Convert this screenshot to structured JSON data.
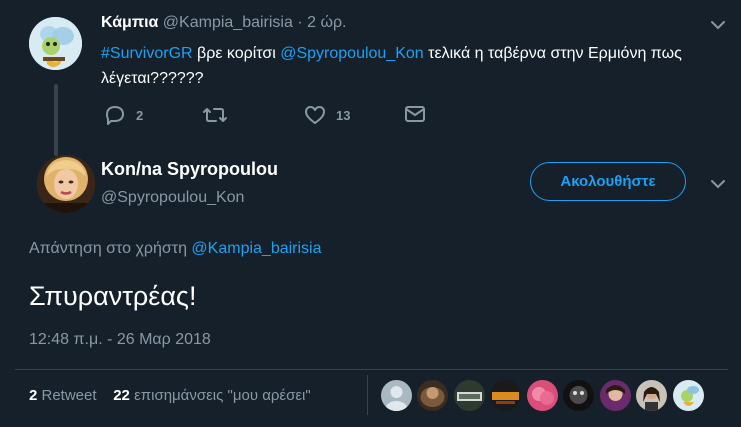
{
  "parent_tweet": {
    "author_name": "Κάμπια",
    "author_handle": "@Kampia_bairisia",
    "separator": "·",
    "time_ago": "2 ώρ.",
    "text_hashtag": "#SurvivorGR",
    "text_part1": " βρε κορίτσι ",
    "text_mention": "@Spyropoulou_Kon",
    "text_part2": " τελικά η ταβέρνα στην Ερμιόνη πως λέγεται??????",
    "reply_count": "2",
    "like_count": "13"
  },
  "main_tweet": {
    "author_name": "Kon/na Spyropoulou",
    "author_handle": "@Spyropoulou_Kon",
    "follow_label": "Ακολουθήστε",
    "reply_prefix": "Απάντηση στο χρήστη ",
    "reply_mention": "@Kampia_bairisia",
    "text": "Σπυραντρέας!",
    "timestamp": "12:48 π.μ. - 26 Μαρ 2018"
  },
  "stats": {
    "retweet_count": "2",
    "retweet_label": " Retweet",
    "like_count": "22",
    "like_label": " επισημάνσεις \"μου αρέσει\""
  },
  "icons": {
    "reply": "reply-icon",
    "retweet": "retweet-icon",
    "like": "heart-icon",
    "dm": "envelope-icon",
    "caret": "chevron-down-icon"
  },
  "colors": {
    "background": "#15202b",
    "accent": "#1da1f2",
    "secondary_text": "#8899a6",
    "divider": "#38444d"
  }
}
